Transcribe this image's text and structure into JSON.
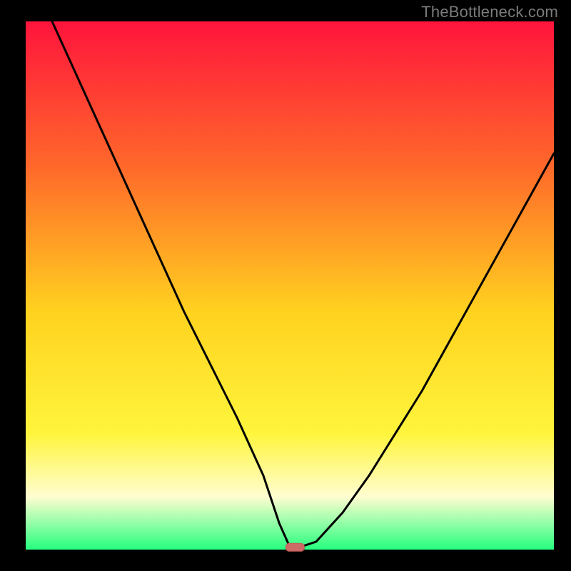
{
  "watermark": "TheBottleneck.com",
  "colors": {
    "background": "#000000",
    "gradient_top": "#ff143c",
    "gradient_upper_mid": "#ff6a2a",
    "gradient_mid": "#ffd21f",
    "gradient_lower_mid": "#fff53c",
    "gradient_pale": "#fffdd0",
    "gradient_bottom": "#26ff7e",
    "curve": "#000000",
    "marker_fill": "#cc6a66",
    "marker_stroke": "#c55a56"
  },
  "plot": {
    "inner_x": 36,
    "inner_y": 30,
    "inner_w": 740,
    "inner_h": 740
  },
  "chart_data": {
    "type": "line",
    "title": "",
    "xlabel": "",
    "ylabel": "",
    "xlim": [
      0,
      100
    ],
    "ylim": [
      0,
      100
    ],
    "grid": false,
    "series": [
      {
        "name": "bottleneck-curve",
        "x": [
          5,
          10,
          15,
          20,
          25,
          30,
          35,
          40,
          45,
          48,
          50,
          52,
          55,
          60,
          65,
          70,
          75,
          80,
          85,
          90,
          95,
          100
        ],
        "y": [
          100,
          89,
          78,
          67,
          56,
          45,
          35,
          25,
          14,
          5,
          0.5,
          0.5,
          1.5,
          7,
          14,
          22,
          30,
          39,
          48,
          57,
          66,
          75
        ]
      }
    ],
    "marker": {
      "x": 51,
      "y": 0.5
    },
    "legend": false
  }
}
